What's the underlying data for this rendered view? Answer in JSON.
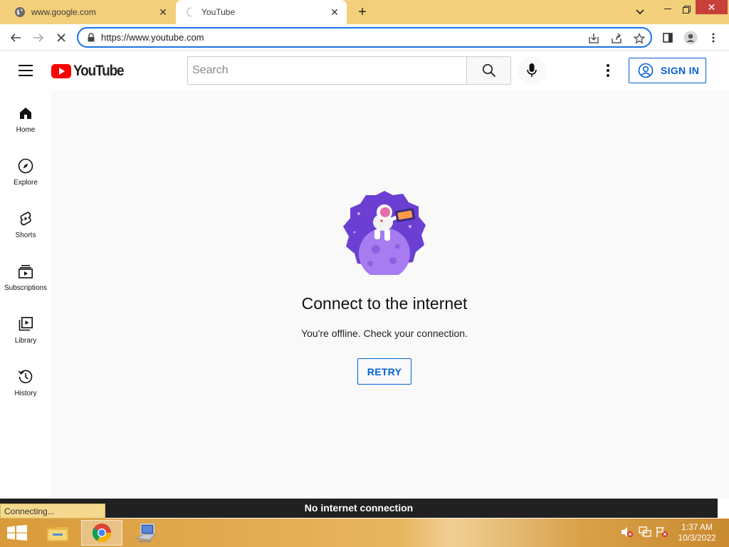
{
  "browser": {
    "tabs": [
      {
        "title": "www.google.com",
        "favicon": "globe-icon",
        "active": false
      },
      {
        "title": "YouTube",
        "favicon": "loading-spinner-icon",
        "active": true
      }
    ],
    "new_tab_label": "+",
    "url": "https://www.youtube.com",
    "status_text": "Connecting...",
    "accent": "#1a73e8",
    "tabstrip_color": "#f2cf7a"
  },
  "youtube": {
    "logo_text": "YouTube",
    "search_placeholder": "Search",
    "sign_in_label": "SIGN IN",
    "guide": [
      {
        "label": "Home",
        "icon": "home-icon"
      },
      {
        "label": "Explore",
        "icon": "compass-icon"
      },
      {
        "label": "Shorts",
        "icon": "shorts-icon"
      },
      {
        "label": "Subscriptions",
        "icon": "subscriptions-icon"
      },
      {
        "label": "Library",
        "icon": "library-icon"
      },
      {
        "label": "History",
        "icon": "history-icon"
      }
    ],
    "offline": {
      "title": "Connect to the internet",
      "subtitle": "You're offline. Check your connection.",
      "retry_label": "RETRY"
    },
    "toast": "No internet connection",
    "brand_red": "#ff0000",
    "link_blue": "#065fd4"
  },
  "taskbar": {
    "apps": [
      "file-explorer-icon",
      "chrome-icon",
      "network-computer-icon"
    ],
    "clock": {
      "time": "1:37 AM",
      "date": "10/3/2022"
    }
  }
}
